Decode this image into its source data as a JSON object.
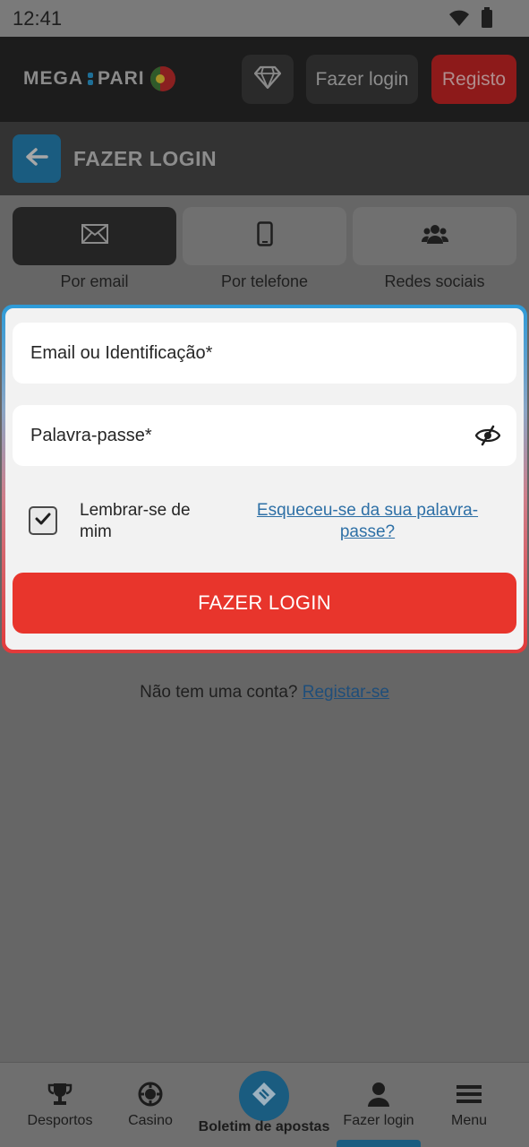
{
  "status_bar": {
    "time": "12:41",
    "icons": [
      "wifi-icon",
      "battery-icon"
    ]
  },
  "header": {
    "logo_left": "MEGA",
    "logo_right": "PARI",
    "diamond_icon": "diamond-icon",
    "login_label": "Fazer login",
    "register_label": "Registo"
  },
  "subheader": {
    "title": "FAZER LOGIN",
    "back_icon": "arrow-left-icon"
  },
  "tabs": [
    {
      "label": "Por email",
      "icon": "envelope-icon",
      "active": true
    },
    {
      "label": "Por telefone",
      "icon": "phone-icon",
      "active": false
    },
    {
      "label": "Redes sociais",
      "icon": "users-icon",
      "active": false
    }
  ],
  "form": {
    "email_placeholder": "Email ou Identificação*",
    "password_placeholder": "Palavra-passe*",
    "remember_label": "Lembrar-se de mim",
    "remember_checked": true,
    "forgot_link": "Esqueceu-se da sua palavra-passe?",
    "submit_label": "FAZER LOGIN"
  },
  "signup": {
    "prompt": "Não tem uma conta?",
    "link": "Registar-se"
  },
  "bottom_nav": {
    "items": [
      {
        "label": "Desportos",
        "icon": "trophy-icon"
      },
      {
        "label": "Casino",
        "icon": "casino-chip-icon"
      },
      {
        "label": "Boletim de apostas",
        "icon": "ticket-icon"
      },
      {
        "label": "Fazer login",
        "icon": "user-icon"
      },
      {
        "label": "Menu",
        "icon": "hamburger-icon"
      }
    ]
  },
  "colors": {
    "accent_blue": "#1a5c80",
    "accent_red": "#e8352c",
    "link_blue": "#2e70a6",
    "overlay_bg": "#666666"
  }
}
